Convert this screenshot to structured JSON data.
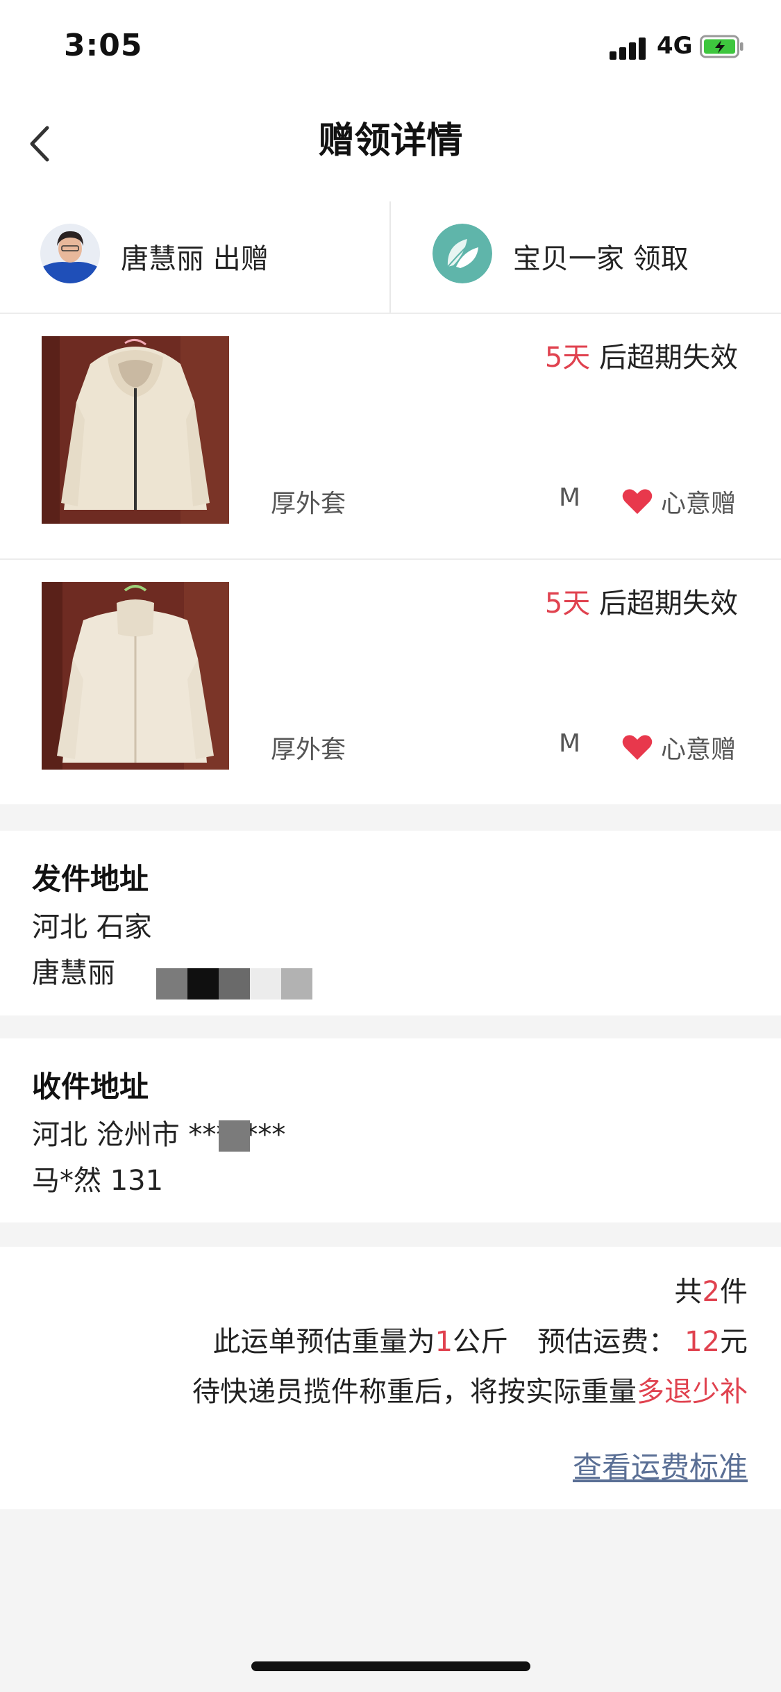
{
  "status_bar": {
    "time": "3:05",
    "network": "4G"
  },
  "nav": {
    "title": "赠领详情"
  },
  "parties": {
    "giver": {
      "name": "唐慧丽",
      "action": "出赠"
    },
    "receiver": {
      "name": "宝贝一家",
      "action": "领取"
    }
  },
  "items": [
    {
      "expire_days": "5天",
      "expire_suffix": " 后超期失效",
      "category": "厚外套",
      "size": "M",
      "gift_type": "心意赠"
    },
    {
      "expire_days": "5天",
      "expire_suffix": " 后超期失效",
      "category": "厚外套",
      "size": "M",
      "gift_type": "心意赠"
    }
  ],
  "send_address": {
    "title": "发件地址",
    "region": "河北 石家",
    "name": "唐慧丽"
  },
  "recv_address": {
    "title": "收件地址",
    "region": "河北 沧州市 *******",
    "contact": "马*然 131"
  },
  "summary": {
    "count_prefix": "共",
    "count": "2",
    "count_suffix": "件",
    "weight_prefix": "此运单预估重量为",
    "weight": "1",
    "weight_unit": "公斤",
    "fee_label": "预估运费：",
    "fee": "12",
    "fee_unit": "元",
    "note_prefix": "待快递员揽件称重后，将按实际重量",
    "note_emphasis": "多退少补",
    "link_label": "查看运费标准"
  },
  "colors": {
    "accent_red": "#e0424f",
    "link": "#5a6f95"
  }
}
